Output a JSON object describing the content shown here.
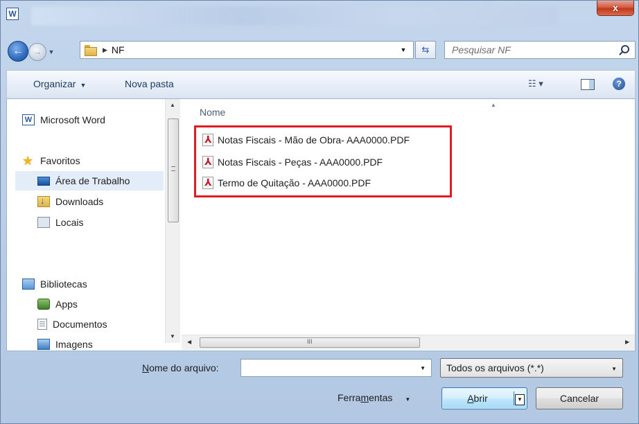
{
  "window": {
    "app_icon": "W",
    "close_symbol": "x"
  },
  "address": {
    "path": [
      "NF"
    ],
    "dropdown_symbol": "▼",
    "refresh_symbol": "⇆"
  },
  "search": {
    "placeholder": "Pesquisar NF"
  },
  "toolbar": {
    "organize_label": "Organizar",
    "new_folder_label": "Nova pasta",
    "views_symbol": "☷ ▾",
    "help_symbol": "?"
  },
  "nav_pane": {
    "items": [
      {
        "label": "Microsoft Word",
        "icon": "word-icon"
      },
      {
        "label": "Favoritos",
        "icon": "star-icon"
      },
      {
        "label": "Área de Trabalho",
        "icon": "desktop-icon",
        "selected": true
      },
      {
        "label": "Downloads",
        "icon": "downloads-icon"
      },
      {
        "label": "Locais",
        "icon": "places-icon"
      },
      {
        "label": "Bibliotecas",
        "icon": "library-icon"
      },
      {
        "label": "Apps",
        "icon": "apps-icon"
      },
      {
        "label": "Documentos",
        "icon": "documents-icon"
      },
      {
        "label": "Imagens",
        "icon": "images-icon"
      }
    ]
  },
  "file_list": {
    "column_header": "Nome",
    "files": [
      {
        "name": "Notas Fiscais - Mão de Obra- AAA0000.PDF",
        "icon": "pdf-icon"
      },
      {
        "name": "Notas Fiscais - Peças - AAA0000.PDF",
        "icon": "pdf-icon"
      },
      {
        "name": "Termo de Quitação - AAA0000.PDF",
        "icon": "pdf-icon"
      }
    ],
    "highlight_color": "#e21b23"
  },
  "bottom": {
    "filename_label_first": "N",
    "filename_label_rest": "ome do arquivo:",
    "filename_value": "",
    "filetype_selected": "Todos os arquivos (*.*)",
    "tools_label_a": "Ferra",
    "tools_label_u": "m",
    "tools_label_b": "entas",
    "open_label_u": "A",
    "open_label_rest": "brir",
    "cancel_label": "Cancelar"
  },
  "scrollbar": {
    "h_grip": "III"
  }
}
